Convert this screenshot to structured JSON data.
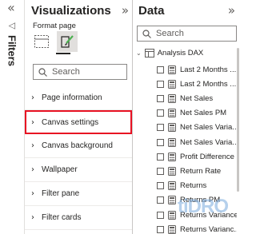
{
  "filters_pane": {
    "collapse_icon": "double-chevron-left",
    "label": "Filters",
    "icon": "funnel-icon"
  },
  "visualizations": {
    "title": "Visualizations",
    "collapse_icon": "double-chevron-right",
    "format_label": "Format page",
    "search_placeholder": "Search",
    "sections": [
      {
        "label": "Page information",
        "highlighted": false
      },
      {
        "label": "Canvas settings",
        "highlighted": true
      },
      {
        "label": "Canvas background",
        "highlighted": false
      },
      {
        "label": "Wallpaper",
        "highlighted": false
      },
      {
        "label": "Filter pane",
        "highlighted": false
      },
      {
        "label": "Filter cards",
        "highlighted": false
      }
    ]
  },
  "data": {
    "title": "Data",
    "collapse_icon": "double-chevron-right",
    "search_placeholder": "Search",
    "table_name": "Analysis DAX",
    "fields": [
      "Last 2 Months ...",
      "Last 2 Months ...",
      "Net Sales",
      "Net Sales PM",
      "Net Sales Varia...",
      "Net Sales Varia...",
      "Profit Difference",
      "Return Rate",
      "Returns",
      "Returns PM",
      "Returns Variance",
      "Returns Varianc..."
    ]
  },
  "watermark": "tiDRO",
  "colors": {
    "highlight_border": "#e81123",
    "text": "#252423",
    "muted": "#605e5c"
  }
}
